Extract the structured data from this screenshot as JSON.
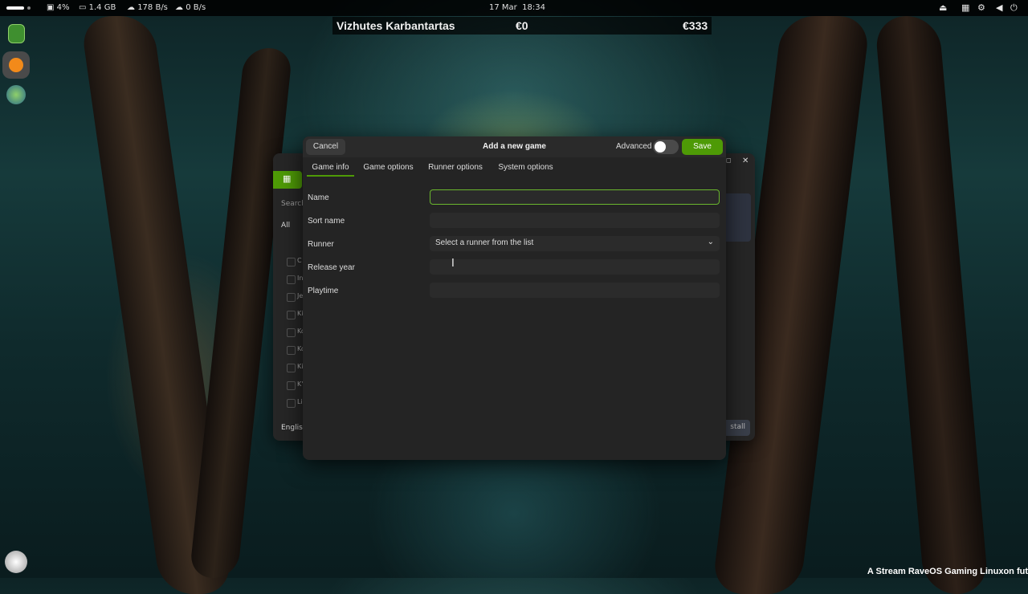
{
  "topbar": {
    "cpu": "4%",
    "memory": "1.4 GB",
    "download": "178 B/s",
    "upload": "0 B/s",
    "date": "17 Mar",
    "time": "18:34"
  },
  "ticker": {
    "name": "Vizhutes Karbantartas",
    "value_left": "€0",
    "value_right": "€333"
  },
  "background_window": {
    "search_placeholder": "Search",
    "filter_all": "All",
    "list_letters": [
      "C",
      "In",
      "Je",
      "Ki",
      "Ko",
      "Ko",
      "Ki",
      "K'",
      "Li"
    ],
    "language": "English",
    "install_label": "stall"
  },
  "dialog": {
    "cancel_label": "Cancel",
    "title": "Add a new game",
    "advanced_label": "Advanced",
    "advanced_on": false,
    "save_label": "Save",
    "tabs": [
      "Game info",
      "Game options",
      "Runner options",
      "System options"
    ],
    "active_tab": "Game info",
    "fields": {
      "name_label": "Name",
      "name_value": "",
      "sort_name_label": "Sort name",
      "sort_name_value": "",
      "runner_label": "Runner",
      "runner_value": "Select a runner from the list",
      "release_year_label": "Release year",
      "release_year_value": "",
      "playtime_label": "Playtime",
      "playtime_value": ""
    }
  },
  "watermark": "A Stream RaveOS Gaming Linuxon fut",
  "colors": {
    "accent": "#4e9a06",
    "focus_border": "#6ab62e",
    "dialog_bg": "#242424"
  }
}
